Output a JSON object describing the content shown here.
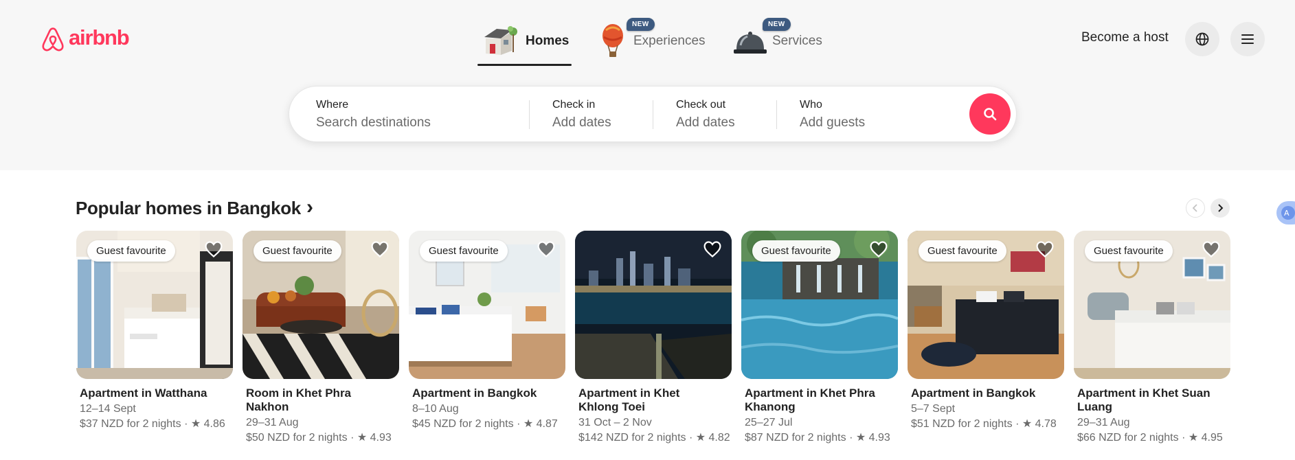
{
  "brand": {
    "name": "airbnb",
    "color": "#FF385C"
  },
  "nav": {
    "tabs": [
      {
        "label": "Homes",
        "icon": "house-icon",
        "active": true
      },
      {
        "label": "Experiences",
        "icon": "hot-air-balloon-icon",
        "badge": "NEW"
      },
      {
        "label": "Services",
        "icon": "service-bell-icon",
        "badge": "NEW"
      }
    ],
    "host_label": "Become a host",
    "globe_icon": "globe-icon",
    "menu_icon": "hamburger-menu-icon"
  },
  "search": {
    "where": {
      "label": "Where",
      "placeholder": "Search destinations"
    },
    "check_in": {
      "label": "Check in",
      "placeholder": "Add dates"
    },
    "check_out": {
      "label": "Check out",
      "placeholder": "Add dates"
    },
    "who": {
      "label": "Who",
      "placeholder": "Add guests"
    },
    "button_icon": "search-icon"
  },
  "section": {
    "title": "Popular homes in Bangkok",
    "title_arrow": "›",
    "prev_icon": "chevron-left-icon",
    "next_icon": "chevron-right-icon"
  },
  "listings": [
    {
      "badge": "Guest favourite",
      "title": "Apartment in Watthana",
      "dates": "12–14 Sept",
      "price": "$37 NZD for 2 nights · ★ 4.86"
    },
    {
      "badge": "Guest favourite",
      "title": "Room in Khet Phra Nakhon",
      "dates": "29–31 Aug",
      "price": "$50 NZD for 2 nights · ★ 4.93"
    },
    {
      "badge": "Guest favourite",
      "title": "Apartment in Bangkok",
      "dates": "8–10 Aug",
      "price": "$45 NZD for 2 nights · ★ 4.87"
    },
    {
      "badge": "",
      "title": "Apartment in Khet Khlong Toei",
      "dates": "31 Oct – 2 Nov",
      "price": "$142 NZD for 2 nights · ★ 4.82"
    },
    {
      "badge": "Guest favourite",
      "title": "Apartment in Khet Phra Khanong",
      "dates": "25–27 Jul",
      "price": "$87 NZD for 2 nights · ★ 4.93"
    },
    {
      "badge": "Guest favourite",
      "title": "Apartment in Bangkok",
      "dates": "5–7 Sept",
      "price": "$51 NZD for 2 nights · ★ 4.78"
    },
    {
      "badge": "Guest favourite",
      "title": "Apartment in Khet Suan Luang",
      "dates": "29–31 Aug",
      "price": "$66 NZD for 2 nights · ★ 4.95"
    }
  ]
}
